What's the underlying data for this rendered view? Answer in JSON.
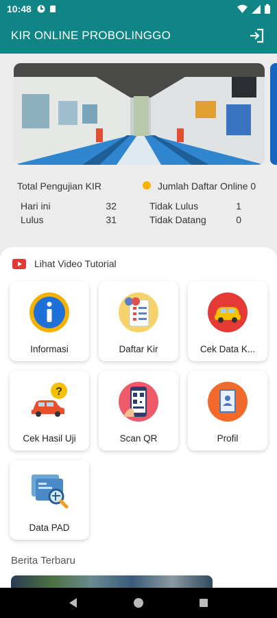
{
  "status_bar": {
    "time": "10:48"
  },
  "app_bar": {
    "title": "KIR ONLINE PROBOLINGGO"
  },
  "stats": {
    "total_label": "Total Pengujian KIR",
    "online_label": "Jumlah Daftar Online 0",
    "hari_ini_label": "Hari ini",
    "hari_ini_value": "32",
    "lulus_label": "Lulus",
    "lulus_value": "31",
    "tidak_lulus_label": "Tidak Lulus",
    "tidak_lulus_value": "1",
    "tidak_datang_label": "Tidak Datang",
    "tidak_datang_value": "0"
  },
  "tutorial": {
    "label": "Lihat Video Tutorial"
  },
  "menu": [
    {
      "label": "Informasi"
    },
    {
      "label": "Daftar Kir"
    },
    {
      "label": "Cek Data K..."
    },
    {
      "label": "Cek Hasil Uji"
    },
    {
      "label": "Scan QR"
    },
    {
      "label": "Profil"
    },
    {
      "label": "Data PAD"
    }
  ],
  "news": {
    "title": "Berita Terbaru"
  },
  "colors": {
    "primary": "#0f8585",
    "accent_dot": "#f4b400",
    "youtube": "#e53935"
  }
}
